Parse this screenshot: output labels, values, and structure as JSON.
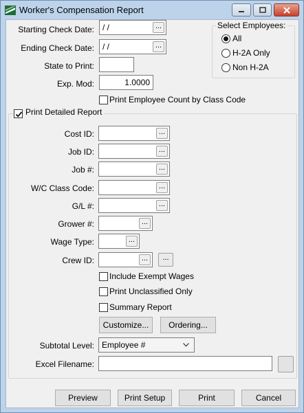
{
  "window": {
    "title": "Worker's Compensation Report"
  },
  "form": {
    "starting_check_date": {
      "label": "Starting Check Date:",
      "value": "/ /"
    },
    "ending_check_date": {
      "label": "Ending Check Date:",
      "value": "/ /"
    },
    "state_to_print": {
      "label": "State to Print:",
      "value": ""
    },
    "exp_mod": {
      "label": "Exp. Mod:",
      "value": "1.0000"
    },
    "print_employee_count": {
      "label": "Print Employee Count by Class Code",
      "checked": false
    },
    "select_employees": {
      "title": "Select Employees:",
      "options": [
        {
          "label": "All",
          "selected": true
        },
        {
          "label": "H-2A Only",
          "selected": false
        },
        {
          "label": "Non H-2A",
          "selected": false
        }
      ]
    },
    "print_detailed_report": {
      "label": "Print Detailed Report",
      "checked": true
    },
    "cost_id": {
      "label": "Cost ID:",
      "value": ""
    },
    "job_id": {
      "label": "Job ID:",
      "value": ""
    },
    "job_num": {
      "label": "Job #:",
      "value": ""
    },
    "wc_class_code": {
      "label": "W/C Class Code:",
      "value": ""
    },
    "gl_num": {
      "label": "G/L #:",
      "value": ""
    },
    "grower_num": {
      "label": "Grower #:",
      "value": ""
    },
    "wage_type": {
      "label": "Wage Type:",
      "value": ""
    },
    "crew_id": {
      "label": "Crew ID:",
      "value": ""
    },
    "include_exempt_wages": {
      "label": "Include Exempt Wages",
      "checked": false
    },
    "print_unclassified_only": {
      "label": "Print Unclassified Only",
      "checked": false
    },
    "summary_report": {
      "label": "Summary Report",
      "checked": false
    },
    "customize_label": "Customize...",
    "ordering_label": "Ordering...",
    "subtotal_level": {
      "label": "Subtotal Level:",
      "value": "Employee #"
    },
    "excel_filename": {
      "label": "Excel Filename:",
      "value": ""
    },
    "ellipsis": "..."
  },
  "footer": {
    "preview": "Preview",
    "print_setup": "Print Setup",
    "print": "Print",
    "cancel": "Cancel"
  }
}
